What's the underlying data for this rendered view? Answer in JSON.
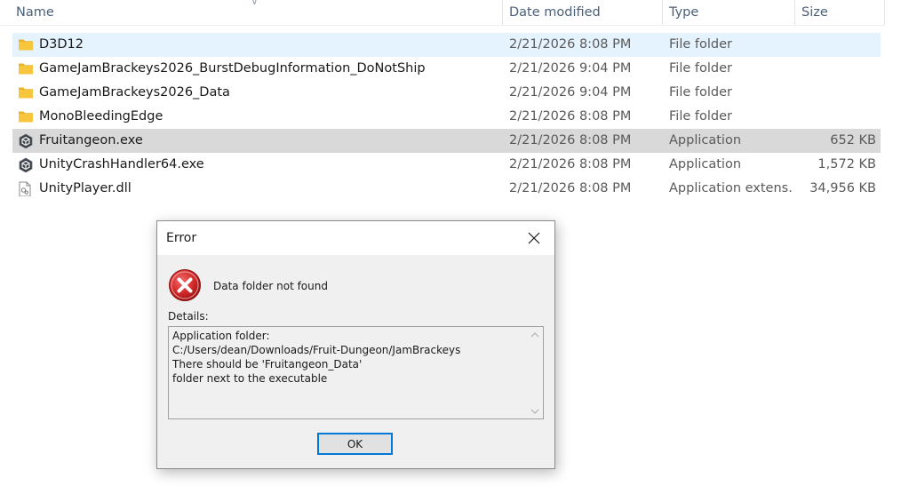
{
  "columns": {
    "name": "Name",
    "date": "Date modified",
    "type": "Type",
    "size": "Size"
  },
  "files": [
    {
      "name": "D3D12",
      "date": "2/21/2026 8:08 PM",
      "type": "File folder",
      "size": "",
      "icon": "folder-icon",
      "state": "hover"
    },
    {
      "name": "GameJamBrackeys2026_BurstDebugInformation_DoNotShip",
      "date": "2/21/2026 9:04 PM",
      "type": "File folder",
      "size": "",
      "icon": "folder-icon",
      "state": ""
    },
    {
      "name": "GameJamBrackeys2026_Data",
      "date": "2/21/2026 9:04 PM",
      "type": "File folder",
      "size": "",
      "icon": "folder-icon",
      "state": ""
    },
    {
      "name": "MonoBleedingEdge",
      "date": "2/21/2026 8:08 PM",
      "type": "File folder",
      "size": "",
      "icon": "folder-icon",
      "state": ""
    },
    {
      "name": "Fruitangeon.exe",
      "date": "2/21/2026 8:08 PM",
      "type": "Application",
      "size": "652 KB",
      "icon": "unity-icon",
      "state": "selected"
    },
    {
      "name": "UnityCrashHandler64.exe",
      "date": "2/21/2026 8:08 PM",
      "type": "Application",
      "size": "1,572 KB",
      "icon": "unity-icon",
      "state": ""
    },
    {
      "name": "UnityPlayer.dll",
      "date": "2/21/2026 8:08 PM",
      "type": "Application extens...",
      "size": "34,956 KB",
      "icon": "dll-file-icon",
      "state": ""
    }
  ],
  "dialog": {
    "title": "Error",
    "message": "Data folder not found",
    "details_label": "Details:",
    "details_lines": [
      "Application folder:",
      "C:/Users/dean/Downloads/Fruit-Dungeon/JamBrackeys",
      "There should be 'Fruitangeon_Data'",
      "folder next to the executable"
    ],
    "ok_label": "OK"
  },
  "colors": {
    "hover_row": "#e5f3ff",
    "selected_row": "#d9d9d9",
    "folder": "#f8c63d",
    "error_red": "#d42a2a",
    "focus_blue": "#0078d7"
  }
}
